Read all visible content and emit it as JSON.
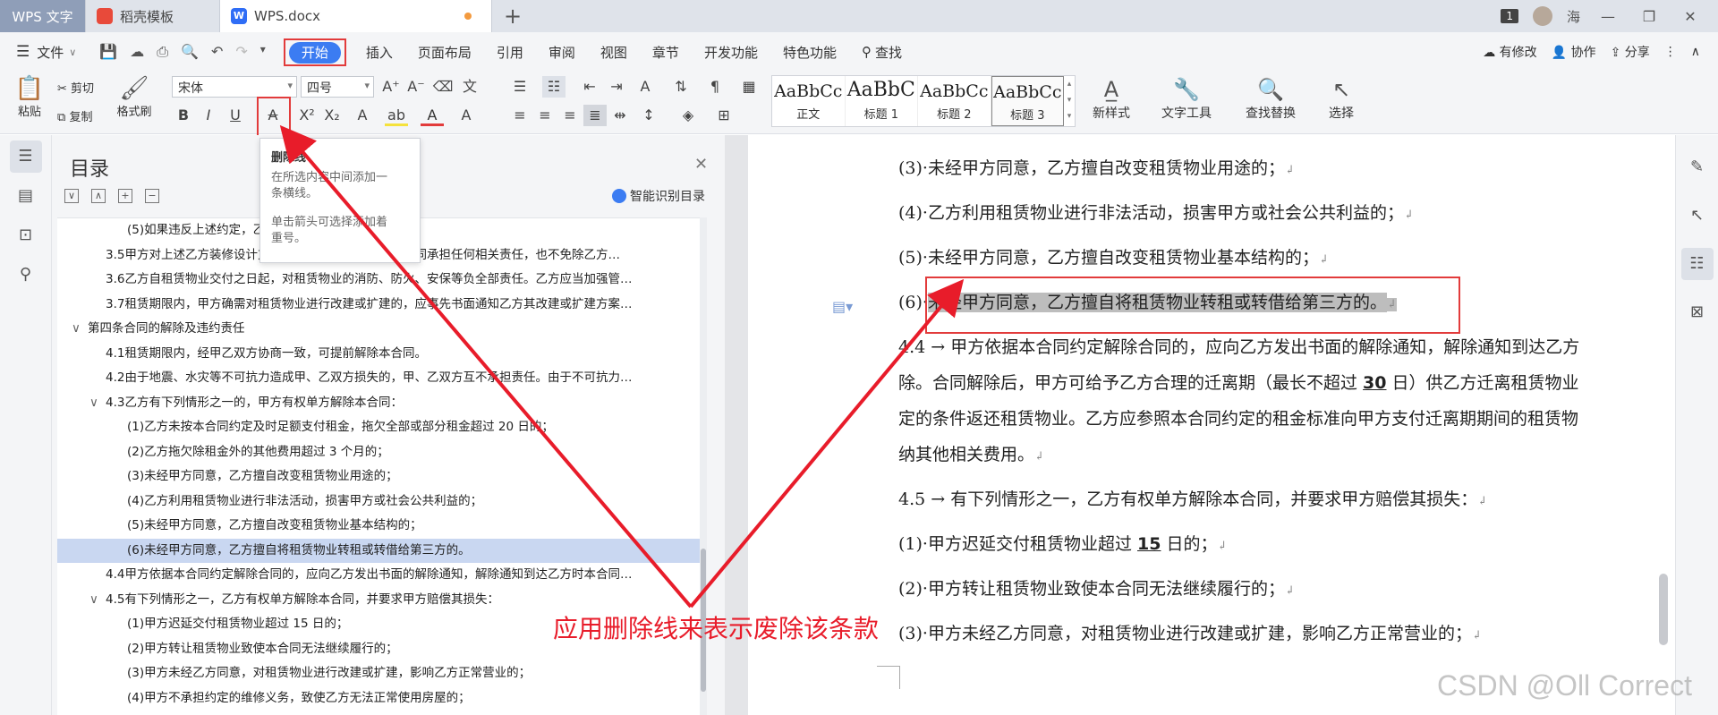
{
  "titlebar": {
    "app_tab": "WPS 文字",
    "template_tab": "稻壳模板",
    "doc_tab": "WPS.docx",
    "badge": "1",
    "user": "海"
  },
  "menubar": {
    "file": "文件",
    "tabs": [
      "开始",
      "插入",
      "页面布局",
      "引用",
      "审阅",
      "视图",
      "章节",
      "开发功能",
      "特色功能"
    ],
    "search": "查找",
    "right": [
      "有修改",
      "协作",
      "分享"
    ]
  },
  "ribbon": {
    "paste": "粘贴",
    "cut": "剪切",
    "copy": "复制",
    "format_painter": "格式刷",
    "font_name": "宋体",
    "font_size": "四号",
    "styles": [
      {
        "sample": "AaBbCc",
        "name": "正文"
      },
      {
        "sample": "AaBbC",
        "name": "标题 1"
      },
      {
        "sample": "AaBbCc",
        "name": "标题 2"
      },
      {
        "sample": "AaBbCc",
        "name": "标题 3"
      }
    ],
    "new_style": "新样式",
    "text_tools": "文字工具",
    "find_replace": "查找替换",
    "select": "选择"
  },
  "tooltip": {
    "title": "删除线",
    "line1": "在所选内容中间添加一",
    "line2": "条横线。",
    "line3": "单击箭头可选择添加着",
    "line4": "重号。"
  },
  "toc": {
    "title": "目录",
    "smart": "智能识别目录",
    "rows": [
      {
        "level": 3,
        "text": "(5)如果违反上述约定，乙方应当赔偿甲方损失。"
      },
      {
        "level": 2,
        "text": "3.5甲方对上述乙方装修设计方案的同意或者认可，并不等同承担任何相关责任，也不免除乙方…"
      },
      {
        "level": 2,
        "text": "3.6乙方自租赁物业交付之日起，对租赁物业的消防、防火、安保等负全部责任。乙方应当加强管…"
      },
      {
        "level": 2,
        "text": "3.7租赁期限内，甲方确需对租赁物业进行改建或扩建的，应事先书面通知乙方其改建或扩建方案…"
      },
      {
        "level": 1,
        "caret": "∨",
        "text": "第四条合同的解除及违约责任"
      },
      {
        "level": 2,
        "text": "4.1租赁期限内，经甲乙双方协商一致，可提前解除本合同。"
      },
      {
        "level": 2,
        "text": "4.2由于地震、水灾等不可抗力造成甲、乙双方损失的，甲、乙双方互不承担责任。由于不可抗力…"
      },
      {
        "level": 2,
        "caret": "∨",
        "text": "4.3乙方有下列情形之一的，甲方有权单方解除本合同："
      },
      {
        "level": 3,
        "text": "(1)乙方未按本合同约定及时足额支付租金，拖欠全部或部分租金超过 20 日的；"
      },
      {
        "level": 3,
        "text": "(2)乙方拖欠除租金外的其他费用超过 3 个月的；"
      },
      {
        "level": 3,
        "text": "(3)未经甲方同意，乙方擅自改变租赁物业用途的；"
      },
      {
        "level": 3,
        "text": "(4)乙方利用租赁物业进行非法活动，损害甲方或社会公共利益的；"
      },
      {
        "level": 3,
        "text": "(5)未经甲方同意，乙方擅自改变租赁物业基本结构的；"
      },
      {
        "level": 3,
        "selected": true,
        "text": "(6)未经甲方同意，乙方擅自将租赁物业转租或转借给第三方的。"
      },
      {
        "level": 2,
        "text": "4.4甲方依据本合同约定解除合同的，应向乙方发出书面的解除通知，解除通知到达乙方时本合同…"
      },
      {
        "level": 2,
        "caret": "∨",
        "text": "4.5有下列情形之一，乙方有权单方解除本合同，并要求甲方赔偿其损失："
      },
      {
        "level": 3,
        "text": "(1)甲方迟延交付租赁物业超过 15 日的；"
      },
      {
        "level": 3,
        "text": "(2)甲方转让租赁物业致使本合同无法继续履行的；"
      },
      {
        "level": 3,
        "text": "(3)甲方未经乙方同意，对租赁物业进行改建或扩建，影响乙方正常营业的；"
      },
      {
        "level": 3,
        "text": "(4)甲方不承担约定的维修义务，致使乙方无法正常使用房屋的；"
      }
    ]
  },
  "doc": {
    "p1": "(3)·未经甲方同意，乙方擅自改变租赁物业用途的；",
    "p2": "(4)·乙方利用租赁物业进行非法活动，损害甲方或社会公共利益的；",
    "p3": "(5)·未经甲方同意，乙方擅自改变租赁物业基本结构的；",
    "p4_num": "(6)·",
    "p4_text": "未经甲方同意，乙方擅自将租赁物业转租或转借给第三方的。",
    "p5_a": "4.4 →  甲方依据本合同约定解除合同的，应向乙方发出书面的解除通知，解除通知到达乙方",
    "p5_b1": "除。合同解除后，甲方可给予乙方合理的迁离期（最长不超过 ",
    "p5_b_num": "30",
    "p5_b2": " 日）供乙方迁离租赁物业",
    "p5_c": "定的条件返还租赁物业。乙方应参照本合同约定的租金标准向甲方支付迁离期期间的租赁物",
    "p5_d": "纳其他相关费用。",
    "p6": "4.5 →  有下列情形之一，乙方有权单方解除本合同，并要求甲方赔偿其损失：",
    "p7_a": "(1)·甲方迟延交付租赁物业超过 ",
    "p7_num": "15",
    "p7_b": " 日的；",
    "p8": "(2)·甲方转让租赁物业致使本合同无法继续履行的；",
    "p9": "(3)·甲方未经乙方同意，对租赁物业进行改建或扩建，影响乙方正常营业的；"
  },
  "annotation": {
    "text": "应用删除线来表示废除该条款",
    "color": "#e81c2a"
  },
  "watermark": "CSDN @Oll Correct",
  "colors": {
    "accent": "#3b7cf2",
    "highlight_box": "#e23b3b",
    "toc_selected": "#c9d7f1"
  }
}
